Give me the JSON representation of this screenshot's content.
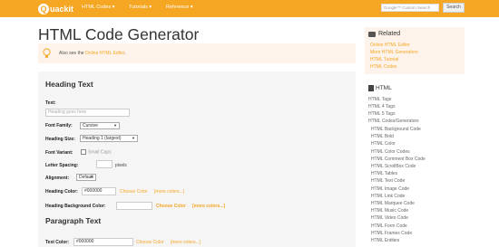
{
  "topbar": {
    "logo_letter": "Q",
    "logo_text": "uackit",
    "nav": [
      "HTML Codes ▾",
      "Tutorials ▾",
      "Reference ▾"
    ],
    "search_placeholder": "Google™ Custom Search",
    "search_button": "Search"
  },
  "page": {
    "title": "HTML Code Generator",
    "tip_prefix": "Also see the ",
    "tip_link": "Online HTML Editor",
    "tip_suffix": "."
  },
  "heading_section": {
    "title": "Heading Text",
    "text_label": "Text:",
    "text_placeholder": "Heading goes here",
    "font_family_label": "Font Family:",
    "font_family_value": "Cursive",
    "heading_size_label": "Heading Size:",
    "heading_size_value": "Heading 1 (largest)",
    "font_variant_label": "Font Variant:",
    "font_variant_option": "Small Caps",
    "letter_spacing_label": "Letter Spacing:",
    "letter_spacing_unit": "pixels",
    "alignment_label": "Alignment:",
    "alignment_value": "Default",
    "heading_color_label": "Heading Color:",
    "heading_color_value": "#000000",
    "choose_color": "Choose Color",
    "more_colors": "[more colors...]",
    "bg_color_label": "Heading Background Color:"
  },
  "paragraph_section": {
    "title": "Paragraph Text",
    "text_color_label": "Text Color:",
    "text_color_value": "#000000",
    "choose_color": "Choose Color",
    "more_colors": "[more colors...]"
  },
  "related": {
    "title": "Related",
    "items": [
      "Online HTML Editor",
      "More HTML Generators",
      "HTML Tutorial",
      "HTML Codes"
    ]
  },
  "sidebar": {
    "heading": "HTML",
    "items": [
      "HTML Tags",
      "HTML 4 Tags",
      "HTML 5 Tags",
      "HTML Codes/Generators"
    ],
    "sub_items": [
      "HTML Background Code",
      "HTML Bold",
      "HTML Color",
      "HTML Color Codes",
      "HTML Comment Box Code",
      "HTML ScrollBox Code",
      "HTML Tables",
      "HTML Text Code",
      "HTML Image Code",
      "HTML Link Code",
      "HTML Marquee Code",
      "HTML Music Code",
      "HTML Video Code",
      "HTML Form Code",
      "HTML Frames Code",
      "HTML Entities"
    ]
  },
  "colors": {
    "brand": "#f5a623",
    "panel": "#f5f5f5",
    "tip_bg": "#fdf3ea"
  }
}
